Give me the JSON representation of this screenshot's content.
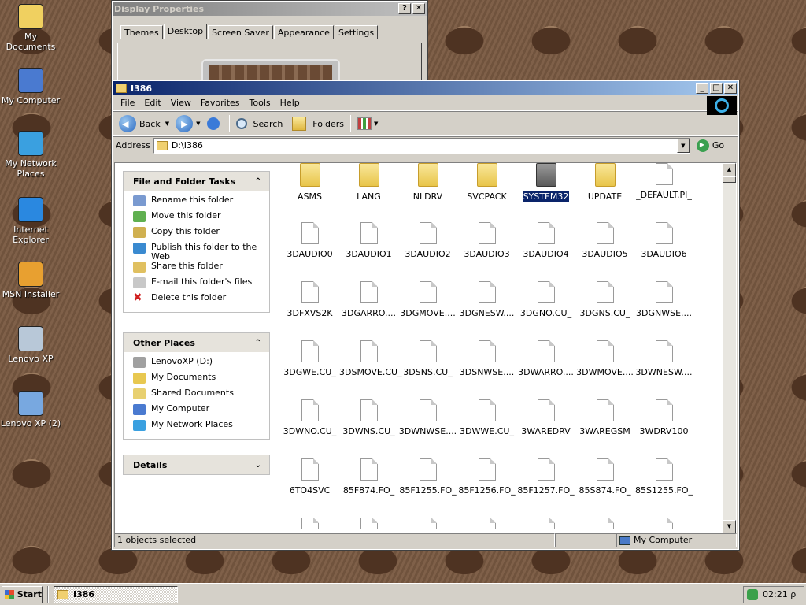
{
  "desktop": {
    "icons": [
      {
        "label": "My Documents",
        "icon": "my-documents-icon"
      },
      {
        "label": "My Computer",
        "icon": "my-computer-icon"
      },
      {
        "label": "My Network Places",
        "icon": "network-places-icon"
      },
      {
        "label": "Internet Explorer",
        "icon": "internet-explorer-icon"
      },
      {
        "label": "MSN Installer",
        "icon": "msn-installer-icon"
      },
      {
        "label": "Lenovo XP",
        "icon": "lenovo-xp-icon"
      },
      {
        "label": "Lenovo XP (2)",
        "icon": "lenovo-xp-2-icon"
      }
    ]
  },
  "display_properties": {
    "title": "Display Properties",
    "help_btn": "?",
    "close_btn": "✕",
    "tabs": [
      "Themes",
      "Desktop",
      "Screen Saver",
      "Appearance",
      "Settings"
    ],
    "active_tab": "Desktop"
  },
  "explorer": {
    "title": "I386",
    "min_btn": "_",
    "max_btn": "□",
    "close_btn": "✕",
    "menu": [
      "File",
      "Edit",
      "View",
      "Favorites",
      "Tools",
      "Help"
    ],
    "toolbar": {
      "back": "Back",
      "search": "Search",
      "folders": "Folders"
    },
    "address_label": "Address",
    "address_value": "D:\\I386",
    "go_label": "Go",
    "tasks_panel": {
      "title": "File and Folder Tasks",
      "items": [
        {
          "label": "Rename this folder",
          "icon": "rename-icon"
        },
        {
          "label": "Move this folder",
          "icon": "move-icon"
        },
        {
          "label": "Copy this folder",
          "icon": "copy-icon"
        },
        {
          "label": "Publish this folder to the Web",
          "icon": "publish-web-icon"
        },
        {
          "label": "Share this folder",
          "icon": "share-icon"
        },
        {
          "label": "E-mail this folder's files",
          "icon": "email-icon"
        },
        {
          "label": "Delete this folder",
          "icon": "delete-icon"
        }
      ]
    },
    "places_panel": {
      "title": "Other Places",
      "items": [
        {
          "label": "LenovoXP (D:)",
          "icon": "drive-icon"
        },
        {
          "label": "My Documents",
          "icon": "my-documents-icon"
        },
        {
          "label": "Shared Documents",
          "icon": "shared-documents-icon"
        },
        {
          "label": "My Computer",
          "icon": "my-computer-icon"
        },
        {
          "label": "My Network Places",
          "icon": "network-places-icon"
        }
      ]
    },
    "details_panel": {
      "title": "Details"
    },
    "files": [
      {
        "name": "ASMS",
        "type": "folder"
      },
      {
        "name": "LANG",
        "type": "folder"
      },
      {
        "name": "NLDRV",
        "type": "folder"
      },
      {
        "name": "SVCPACK",
        "type": "folder"
      },
      {
        "name": "SYSTEM32",
        "type": "folder",
        "selected": true
      },
      {
        "name": "UPDATE",
        "type": "folder"
      },
      {
        "name": "_DEFAULT.PI_",
        "type": "file"
      },
      {
        "name": "3DAUDIO0",
        "type": "file"
      },
      {
        "name": "3DAUDIO1",
        "type": "file"
      },
      {
        "name": "3DAUDIO2",
        "type": "file"
      },
      {
        "name": "3DAUDIO3",
        "type": "file"
      },
      {
        "name": "3DAUDIO4",
        "type": "file"
      },
      {
        "name": "3DAUDIO5",
        "type": "file"
      },
      {
        "name": "3DAUDIO6",
        "type": "file"
      },
      {
        "name": "3DFXVS2K",
        "type": "file"
      },
      {
        "name": "3DGARRO....",
        "type": "file"
      },
      {
        "name": "3DGMOVE....",
        "type": "file"
      },
      {
        "name": "3DGNESW....",
        "type": "file"
      },
      {
        "name": "3DGNO.CU_",
        "type": "file"
      },
      {
        "name": "3DGNS.CU_",
        "type": "file"
      },
      {
        "name": "3DGNWSE....",
        "type": "file"
      },
      {
        "name": "3DGWE.CU_",
        "type": "file"
      },
      {
        "name": "3DSMOVE.CU_",
        "type": "file"
      },
      {
        "name": "3DSNS.CU_",
        "type": "file"
      },
      {
        "name": "3DSNWSE....",
        "type": "file"
      },
      {
        "name": "3DWARRO....",
        "type": "file"
      },
      {
        "name": "3DWMOVE....",
        "type": "file"
      },
      {
        "name": "3DWNESW....",
        "type": "file"
      },
      {
        "name": "3DWNO.CU_",
        "type": "file"
      },
      {
        "name": "3DWNS.CU_",
        "type": "file"
      },
      {
        "name": "3DWNWSE....",
        "type": "file"
      },
      {
        "name": "3DWWE.CU_",
        "type": "file"
      },
      {
        "name": "3WAREDRV",
        "type": "file"
      },
      {
        "name": "3WAREGSM",
        "type": "file"
      },
      {
        "name": "3WDRV100",
        "type": "file"
      },
      {
        "name": "6TO4SVC",
        "type": "file"
      },
      {
        "name": "85F874.FO_",
        "type": "file"
      },
      {
        "name": "85F1255.FO_",
        "type": "file"
      },
      {
        "name": "85F1256.FO_",
        "type": "file"
      },
      {
        "name": "85F1257.FO_",
        "type": "file"
      },
      {
        "name": "85S874.FO_",
        "type": "file"
      },
      {
        "name": "85S1255.FO_",
        "type": "file"
      }
    ],
    "status": {
      "selection": "1 objects selected",
      "zone": "My Computer"
    }
  },
  "taskbar": {
    "start_label": "Start",
    "tasks": [
      {
        "label": "I386",
        "icon": "folder-icon"
      }
    ],
    "clock": "02:21 ρ"
  }
}
